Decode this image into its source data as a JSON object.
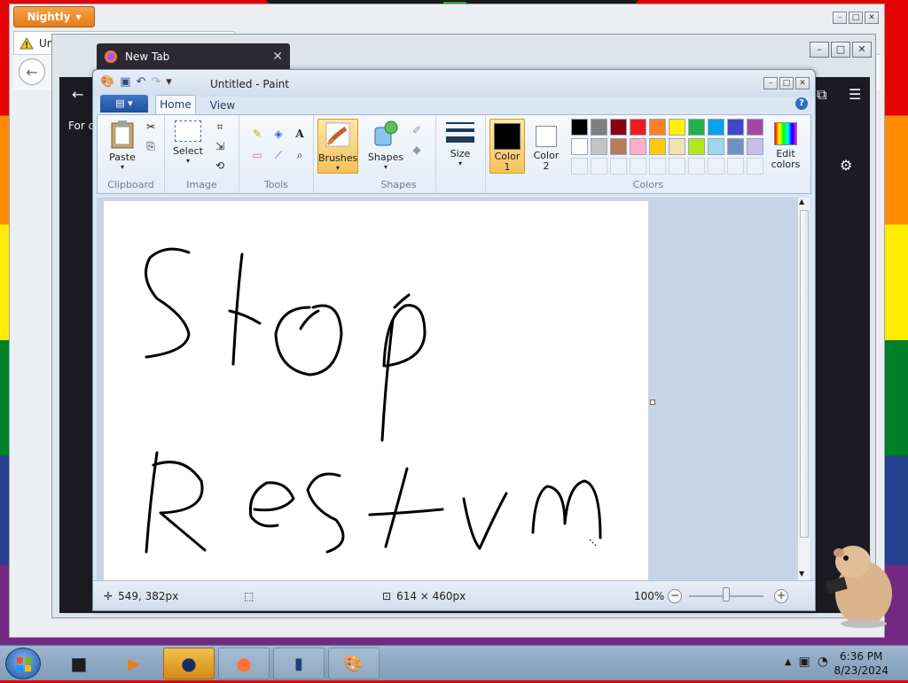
{
  "nightly": {
    "app_button": "Nightly",
    "tab_label": "Unt"
  },
  "firefox": {
    "tab_title": "New Tab",
    "content_snippet": "For q"
  },
  "paint": {
    "window_title": "Untitled - Paint",
    "tabs": [
      "Home",
      "View"
    ],
    "groups": {
      "clipboard": {
        "label": "Clipboard",
        "paste": "Paste"
      },
      "image": {
        "label": "Image",
        "select": "Select"
      },
      "tools": {
        "label": "Tools"
      },
      "brushes": {
        "label": "Brushes"
      },
      "shapes": {
        "label": "Shapes",
        "shapes_btn": "Shapes"
      },
      "size": {
        "label": "Size"
      },
      "colors": {
        "label": "Colors",
        "color1": "Color\n1",
        "color1_l1": "Color",
        "color1_l2": "1",
        "color2_l1": "Color",
        "color2_l2": "2",
        "edit_l1": "Edit",
        "edit_l2": "colors",
        "color1_value": "#000000",
        "color2_value": "#ffffff",
        "palette_row1": [
          "#000000",
          "#7f7f7f",
          "#880015",
          "#ed1c24",
          "#ff7f27",
          "#fff200",
          "#22b14c",
          "#00a2e8",
          "#3f48cc",
          "#a349a4"
        ],
        "palette_row2": [
          "#ffffff",
          "#c3c3c3",
          "#b97a57",
          "#ffaec9",
          "#ffc90e",
          "#efe4b0",
          "#b5e61d",
          "#99d9ea",
          "#7092be",
          "#c8bfe7"
        ]
      }
    },
    "status": {
      "cursor_pos": "549, 382px",
      "canvas_size": "614 × 460px",
      "zoom": "100%"
    },
    "canvas_text": [
      "Stop",
      "Restrm"
    ]
  },
  "taskbar": {
    "time": "6:36 PM",
    "date": "8/23/2024"
  }
}
